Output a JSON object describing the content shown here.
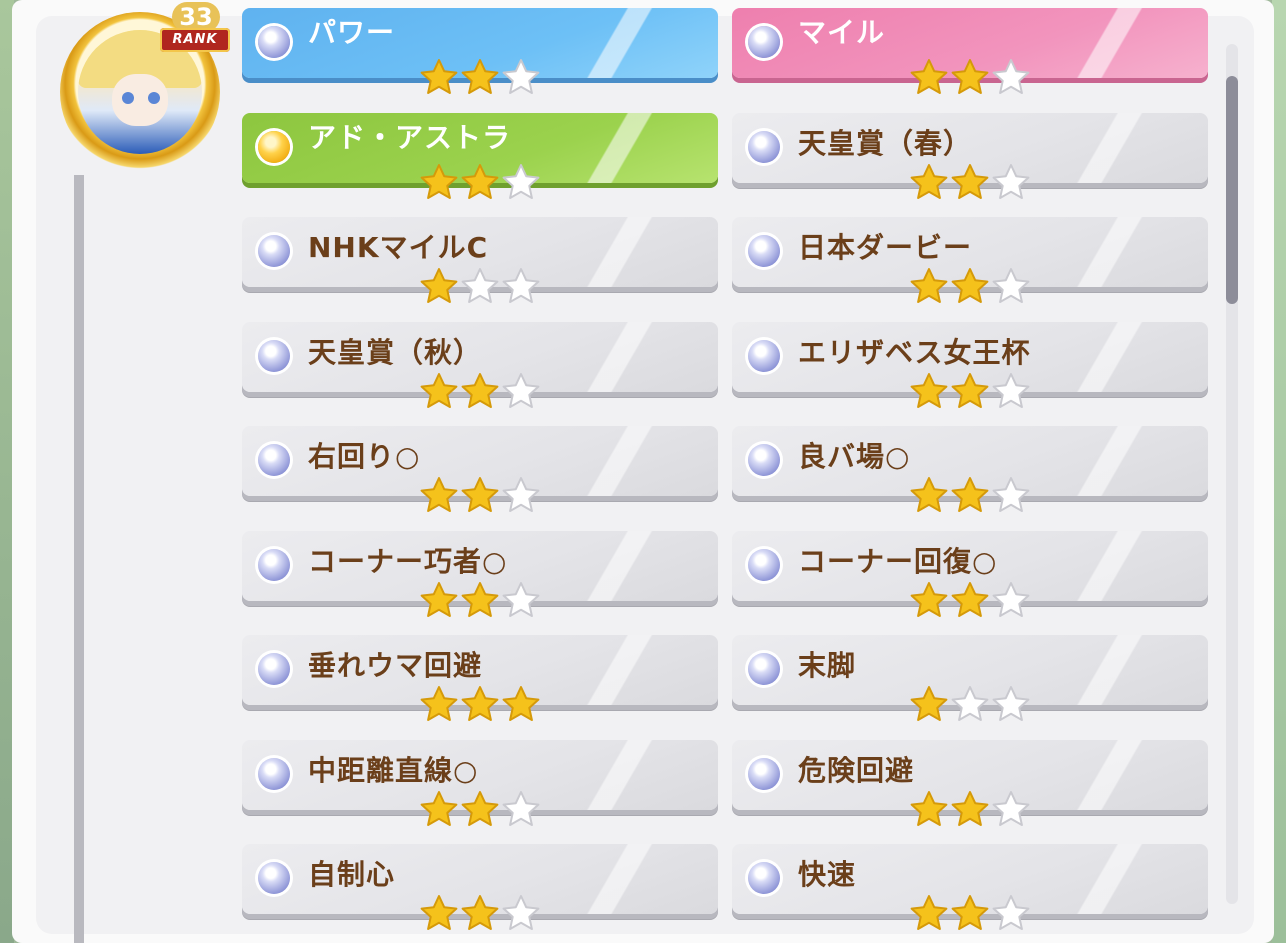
{
  "profile": {
    "rank_number": "33",
    "rank_label": "RANK"
  },
  "colors": {
    "gold_star": "#f5c21b",
    "empty_star": "#ffffff",
    "label_text": "#6b3f1a",
    "blue_card": "#5fb2ef",
    "pink_card": "#ee7fae",
    "green_card": "#8dc63f"
  },
  "skills_left": [
    {
      "label": "パワー",
      "stars": 2,
      "style": "blue",
      "orb": "silver"
    },
    {
      "label": "アド・アストラ",
      "stars": 2,
      "style": "green",
      "orb": "gold"
    },
    {
      "label": "NHKマイルC",
      "stars": 1,
      "style": "grey",
      "orb": "silver"
    },
    {
      "label": "天皇賞（秋）",
      "stars": 2,
      "style": "grey",
      "orb": "silver"
    },
    {
      "label": "右回り○",
      "stars": 2,
      "style": "grey",
      "orb": "silver"
    },
    {
      "label": "コーナー巧者○",
      "stars": 2,
      "style": "grey",
      "orb": "silver"
    },
    {
      "label": "垂れウマ回避",
      "stars": 3,
      "style": "grey",
      "orb": "silver"
    },
    {
      "label": "中距離直線○",
      "stars": 2,
      "style": "grey",
      "orb": "silver"
    },
    {
      "label": "自制心",
      "stars": 2,
      "style": "grey",
      "orb": "silver"
    }
  ],
  "skills_right": [
    {
      "label": "マイル",
      "stars": 2,
      "style": "pink",
      "orb": "silver"
    },
    {
      "label": "天皇賞（春）",
      "stars": 2,
      "style": "grey",
      "orb": "silver"
    },
    {
      "label": "日本ダービー",
      "stars": 2,
      "style": "grey",
      "orb": "silver"
    },
    {
      "label": "エリザベス女王杯",
      "stars": 2,
      "style": "grey",
      "orb": "silver"
    },
    {
      "label": "良バ場○",
      "stars": 2,
      "style": "grey",
      "orb": "silver"
    },
    {
      "label": "コーナー回復○",
      "stars": 2,
      "style": "grey",
      "orb": "silver"
    },
    {
      "label": "末脚",
      "stars": 1,
      "style": "grey",
      "orb": "silver"
    },
    {
      "label": "危険回避",
      "stars": 2,
      "style": "grey",
      "orb": "silver"
    },
    {
      "label": "快速",
      "stars": 2,
      "style": "grey",
      "orb": "silver"
    }
  ],
  "max_stars": 3
}
